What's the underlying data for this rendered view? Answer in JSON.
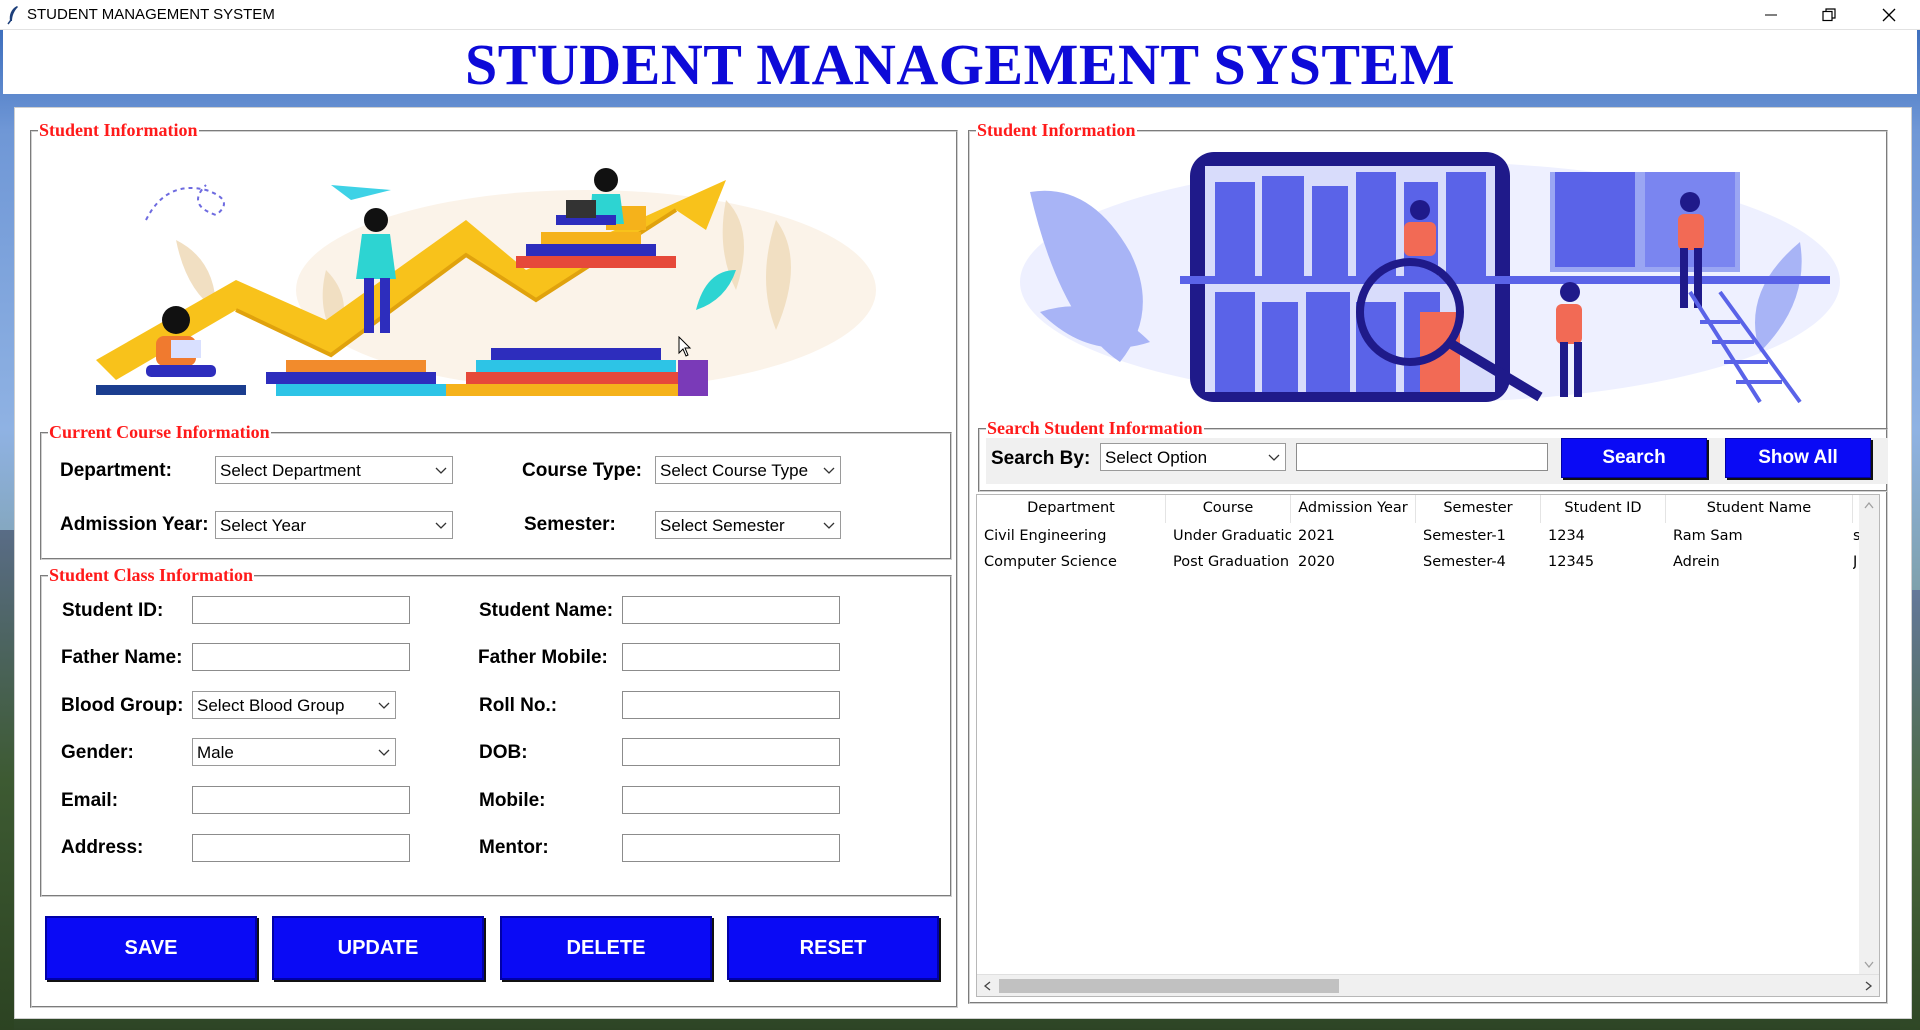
{
  "window": {
    "title": "STUDENT MANAGEMENT SYSTEM",
    "controls": {
      "minimize_icon": "minimize-icon",
      "maximize_icon": "restore-icon",
      "close_icon": "close-icon"
    }
  },
  "heading": "STUDENT MANAGEMENT SYSTEM",
  "colors": {
    "heading": "#0d0ad8",
    "legend": "#ff1a1a",
    "button": "#0a0af5",
    "button_text": "#ffffff"
  },
  "left_panel": {
    "legend": "Student Information",
    "course_section": {
      "legend": "Current Course Information",
      "department_label": "Department:",
      "department_value": "Select Department",
      "course_type_label": "Course Type:",
      "course_type_value": "Select Course Type",
      "admission_year_label": "Admission Year:",
      "admission_year_value": "Select Year",
      "semester_label": "Semester:",
      "semester_value": "Select Semester"
    },
    "class_section": {
      "legend": "Student Class Information",
      "student_id_label": "Student ID:",
      "student_name_label": "Student Name:",
      "father_name_label": "Father Name:",
      "father_mobile_label": "Father Mobile:",
      "blood_group_label": "Blood Group:",
      "blood_group_value": "Select Blood Group",
      "roll_no_label": "Roll No.:",
      "gender_label": "Gender:",
      "gender_value": "Male",
      "dob_label": "DOB:",
      "email_label": "Email:",
      "mobile_label": "Mobile:",
      "address_label": "Address:",
      "mentor_label": "Mentor:"
    },
    "buttons": {
      "save": "SAVE",
      "update": "UPDATE",
      "delete": "DELETE",
      "reset": "RESET"
    }
  },
  "right_panel": {
    "legend": "Student Information",
    "search_section": {
      "legend": "Search Student Information",
      "search_by_label": "Search By:",
      "search_by_value": "Select Option",
      "search_value": "",
      "search_button": "Search",
      "show_all_button": "Show All"
    },
    "table": {
      "columns": [
        "Department",
        "Course",
        "Admission Year",
        "Semester",
        "Student ID",
        "Student Name",
        ""
      ],
      "rows": [
        [
          "Civil Engineering",
          "Under Graduation",
          "2021",
          "Semester-1",
          "1234",
          "Ram Sam",
          "s"
        ],
        [
          "Computer Science",
          "Post Graduation",
          "2020",
          "Semester-4",
          "12345",
          "Adrein",
          "J"
        ]
      ]
    }
  }
}
